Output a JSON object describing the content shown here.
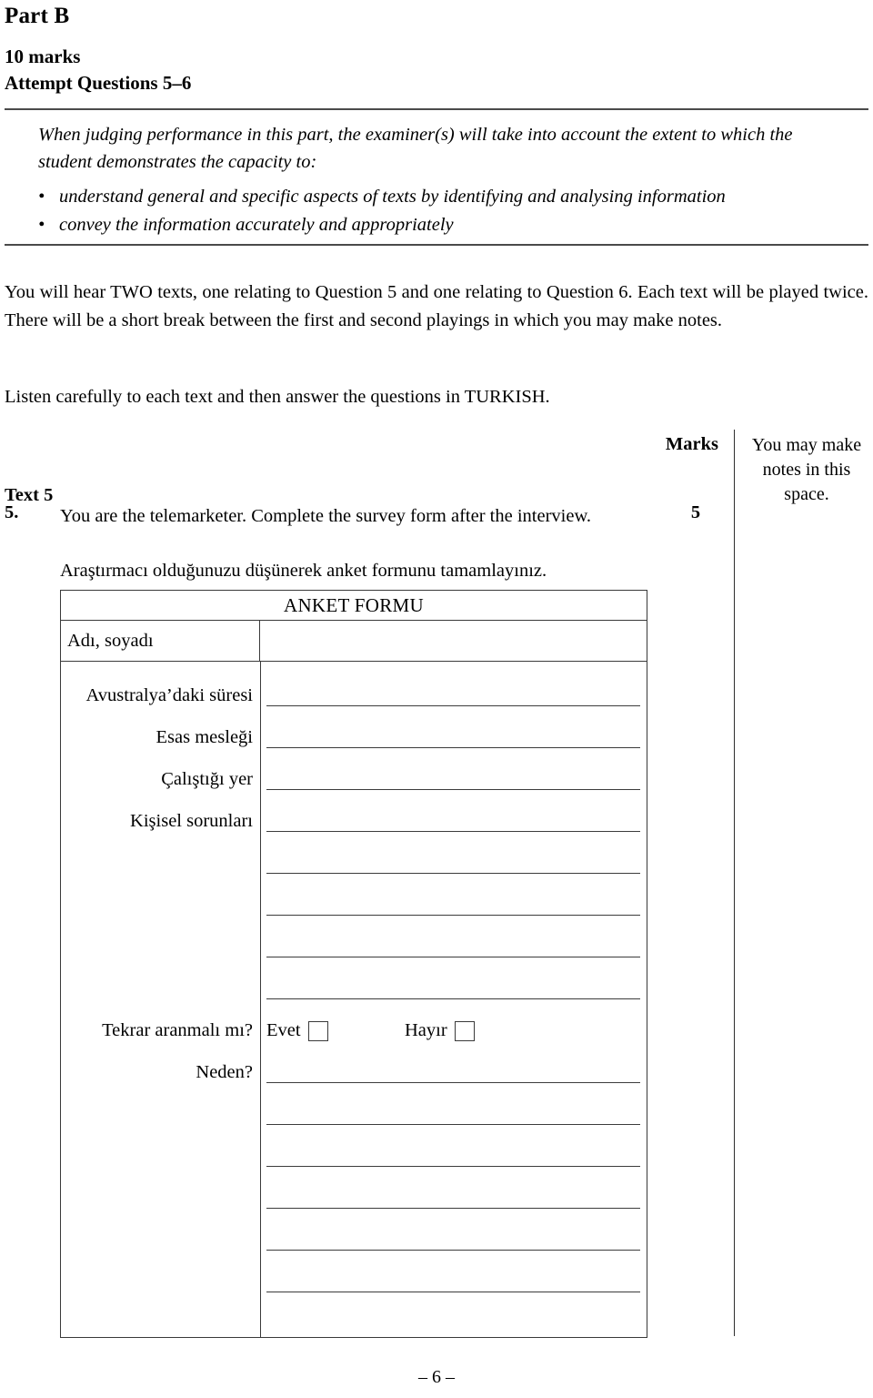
{
  "header": {
    "part_title": "Part B",
    "marks_line": "10 marks",
    "attempt_line": "Attempt Questions 5–6"
  },
  "criteria": {
    "lead": "When judging performance in this part, the examiner(s) will take into account the extent to which the student demonstrates the capacity to:",
    "bullet_glyph": "•",
    "bullets": [
      "understand general and specific aspects of texts by identifying and analysing information",
      "convey the information accurately and appropriately"
    ]
  },
  "instructions": {
    "paragraph_1": "You will hear TWO texts, one relating to Question 5 and one relating to Question 6. Each text will be played twice. There will be a short break between the first and second playings in which you may make notes.",
    "paragraph_2": "Listen carefully to each text and then answer the questions in TURKISH."
  },
  "marks_column": {
    "heading": "Marks",
    "notes_hint": "You may make notes in this space."
  },
  "question": {
    "text_label": "Text 5",
    "number": "5.",
    "prompt": "You are the telemarketer. Complete the survey form after the interview.",
    "prompt_line_1": "You are the telemarketer. Complete the survey form after the",
    "prompt_line_2": "interview.",
    "marks_value": "5",
    "turkish_instruction": "Araştırmacı olduğunuzu düşünerek anket formunu tamamlayınız."
  },
  "survey_form": {
    "title": "ANKET FORMU",
    "name_field_label": "Adı, soyadı",
    "fields": [
      {
        "label": "Avustralya’daki süresi"
      },
      {
        "label": "Esas mesleği"
      },
      {
        "label": "Çalıştığı yer"
      },
      {
        "label": "Kişisel sorunları"
      }
    ],
    "callback_question_label": "Tekrar aranmalı mı?",
    "choice_yes": "Evet",
    "choice_no": "Hayır",
    "reason_label": "Neden?"
  },
  "footer": {
    "page_marker": "– 6 –"
  }
}
